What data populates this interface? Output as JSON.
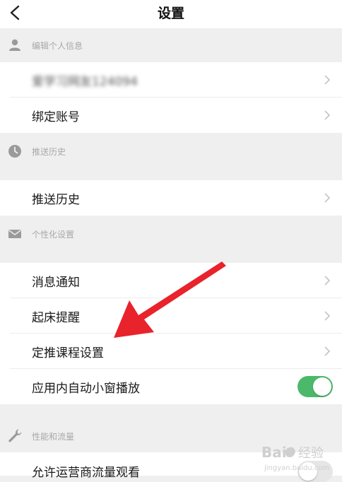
{
  "header": {
    "title": "设置"
  },
  "sections": [
    {
      "title": "编辑个人信息",
      "icon": "person-icon"
    },
    {
      "title": "推送历史",
      "icon": "clock-icon"
    },
    {
      "title": "个性化设置",
      "icon": "envelope-icon"
    },
    {
      "title": "性能和流量",
      "icon": "wrench-icon"
    }
  ],
  "rows": {
    "profile_name": "爱学习网友124094",
    "bind_account": "绑定账号",
    "push_history": "推送历史",
    "notifications": "消息通知",
    "wake_reminder": "起床提醒",
    "course_settings": "定推课程设置",
    "in_app_pip": "应用内自动小窗播放",
    "carrier_data": "允许运营商流量观看"
  },
  "toggles": {
    "in_app_pip": true,
    "carrier_data": false
  },
  "watermark": {
    "brand": "Bai",
    "brand2": "经验",
    "url": "jingyan.baidu.com"
  },
  "colors": {
    "accent_green": "#4bb86a",
    "arrow_red": "#e8232b",
    "section_bg": "#efefef"
  }
}
